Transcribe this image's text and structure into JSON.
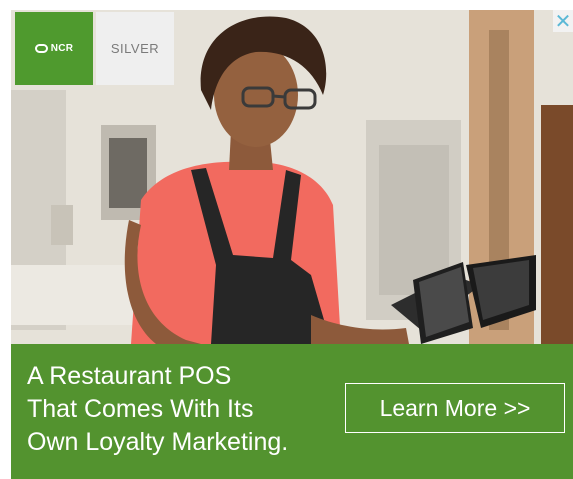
{
  "ad": {
    "logos": {
      "ncr": "NCR",
      "silver": "SILVER"
    },
    "close_glyph": "✕",
    "headline": [
      "A Restaurant POS",
      "That Comes With Its",
      "Own Loyalty Marketing."
    ],
    "cta_label": "Learn More >>"
  },
  "colors": {
    "banner_green": "#53932f",
    "logo_green": "#4f9a2e",
    "close_blue": "#5bb8d6"
  },
  "icons": [
    "close-icon",
    "ncr-logo-icon",
    "silver-logo-icon"
  ]
}
